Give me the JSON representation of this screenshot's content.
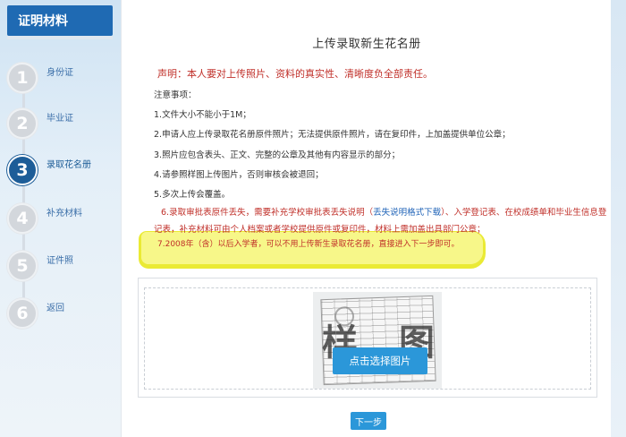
{
  "sidebar": {
    "header": "证明材料",
    "steps": [
      {
        "num": "1",
        "label": "身份证"
      },
      {
        "num": "2",
        "label": "毕业证"
      },
      {
        "num": "3",
        "label": "录取花名册"
      },
      {
        "num": "4",
        "label": "补充材料"
      },
      {
        "num": "5",
        "label": "证件照"
      },
      {
        "num": "6",
        "label": "返回"
      }
    ],
    "active_step": 3
  },
  "main": {
    "title": "上传录取新生花名册",
    "declaration": "声明：本人要对上传照片、资料的真实性、清晰度负全部责任。",
    "notes_heading": "注意事项：",
    "notes": [
      "1.文件大小不能小于1M；",
      "2.申请人应上传录取花名册原件照片；无法提供原件照片，请在复印件，上加盖提供单位公章；",
      "3.照片应包含表头、正文、完整的公章及其他有内容显示的部分；",
      "4.请参照样图上传图片，否则审核会被退回；",
      "5.多次上传会覆盖。"
    ],
    "note6_pre": "6.录取审批表原件丢失，需要补充学校审批表丢失说明（",
    "note6_link": "丢失说明格式下载",
    "note6_post": "）、入学登记表、在校成绩单和毕业生信息登记表，补充材料可由个人档案或者学校提供原件或复印件，材料上需加盖出具部门公章；",
    "note7": "7.2008年（含）以后入学者，可以不用上传新生录取花名册，直接进入下一步即可。",
    "sample_watermark": [
      "样",
      "图"
    ],
    "upload_button": "点击选择图片",
    "next_button": "下一步"
  },
  "colors": {
    "accent": "#1f6ab3",
    "active_step": "#1d5d98",
    "warning_red": "#c0302a",
    "button_blue": "#2b97d9",
    "highlight": "#f0f028"
  }
}
